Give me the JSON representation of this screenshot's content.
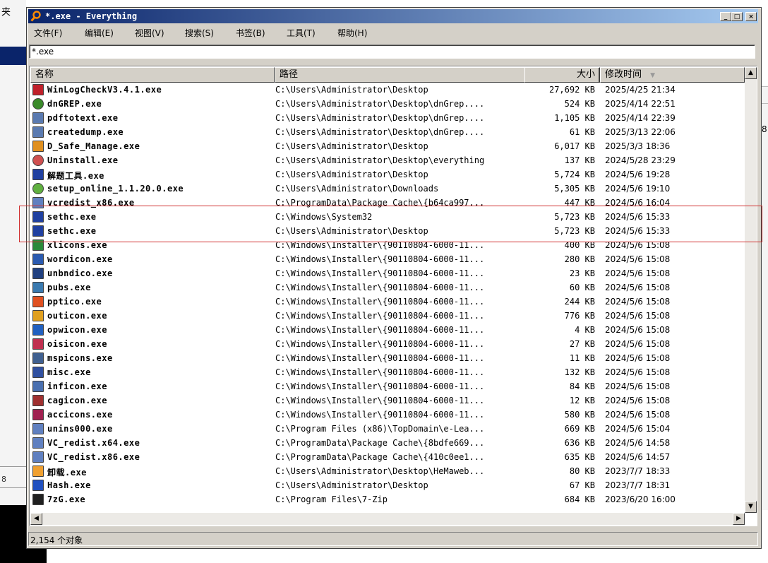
{
  "background": {
    "left_char": "夹",
    "left_number": "8",
    "right_char": "8"
  },
  "window": {
    "title": "*.exe - Everything",
    "min_label": "_",
    "max_label": "□",
    "close_label": "×"
  },
  "menu": [
    "文件(F)",
    "编辑(E)",
    "视图(V)",
    "搜索(S)",
    "书签(B)",
    "工具(T)",
    "帮助(H)"
  ],
  "search": {
    "value": "*.exe"
  },
  "columns": {
    "name": "名称",
    "path": "路径",
    "size": "大小",
    "modified": "修改时间",
    "sort_indicator": "▼"
  },
  "rows": [
    {
      "name": "WinLogCheckV3.4.1.exe",
      "path": "C:\\Users\\Administrator\\Desktop",
      "size": "27,692 KB",
      "modified": "2025/4/25 21:34",
      "icon": "winlogcheck-icon",
      "color": "#c0202a"
    },
    {
      "name": "dnGREP.exe",
      "path": "C:\\Users\\Administrator\\Desktop\\dnGrep....",
      "size": "524 KB",
      "modified": "2025/4/14 22:51",
      "icon": "magnifier-icon",
      "color": "#3a8a2a"
    },
    {
      "name": "pdftotext.exe",
      "path": "C:\\Users\\Administrator\\Desktop\\dnGrep....",
      "size": "1,105 KB",
      "modified": "2025/4/14 22:39",
      "icon": "console-app-icon",
      "color": "#5a7ab0"
    },
    {
      "name": "createdump.exe",
      "path": "C:\\Users\\Administrator\\Desktop\\dnGrep....",
      "size": "61 KB",
      "modified": "2025/3/13 22:06",
      "icon": "console-app-icon",
      "color": "#5a7ab0"
    },
    {
      "name": "D_Safe_Manage.exe",
      "path": "C:\\Users\\Administrator\\Desktop",
      "size": "6,017 KB",
      "modified": "2025/3/3 18:36",
      "icon": "dsafe-icon",
      "color": "#e09020"
    },
    {
      "name": "Uninstall.exe",
      "path": "C:\\Users\\Administrator\\Desktop\\everything",
      "size": "137 KB",
      "modified": "2024/5/28 23:29",
      "icon": "uninstall-icon",
      "color": "#d05050"
    },
    {
      "name": "解题工具.exe",
      "path": "C:\\Users\\Administrator\\Desktop",
      "size": "5,724 KB",
      "modified": "2024/5/6 19:28",
      "icon": "tool-app-icon",
      "color": "#2040a0"
    },
    {
      "name": "setup_online_1.1.20.0.exe",
      "path": "C:\\Users\\Administrator\\Downloads",
      "size": "5,305 KB",
      "modified": "2024/5/6 19:10",
      "icon": "setup-icon",
      "color": "#60b040"
    },
    {
      "name": "vcredist_x86.exe",
      "path": "C:\\ProgramData\\Package Cache\\{b64ca997...",
      "size": "447 KB",
      "modified": "2024/5/6 16:04",
      "icon": "installer-icon",
      "color": "#6080c0"
    },
    {
      "name": "sethc.exe",
      "path": "C:\\Windows\\System32",
      "size": "5,723 KB",
      "modified": "2024/5/6 15:33",
      "icon": "sethc-icon",
      "color": "#2040a0"
    },
    {
      "name": "sethc.exe",
      "path": "C:\\Users\\Administrator\\Desktop",
      "size": "5,723 KB",
      "modified": "2024/5/6 15:33",
      "icon": "sethc-icon",
      "color": "#2040a0"
    },
    {
      "name": "xlicons.exe",
      "path": "C:\\Windows\\Installer\\{90110804-6000-11...",
      "size": "400 KB",
      "modified": "2024/5/6 15:08",
      "icon": "excel-icon",
      "color": "#2a8a3a"
    },
    {
      "name": "wordicon.exe",
      "path": "C:\\Windows\\Installer\\{90110804-6000-11...",
      "size": "280 KB",
      "modified": "2024/5/6 15:08",
      "icon": "word-icon",
      "color": "#2a5ab0"
    },
    {
      "name": "unbndico.exe",
      "path": "C:\\Windows\\Installer\\{90110804-6000-11...",
      "size": "23 KB",
      "modified": "2024/5/6 15:08",
      "icon": "unbound-icon",
      "color": "#204080"
    },
    {
      "name": "pubs.exe",
      "path": "C:\\Windows\\Installer\\{90110804-6000-11...",
      "size": "60 KB",
      "modified": "2024/5/6 15:08",
      "icon": "publisher-icon",
      "color": "#3a7ab0"
    },
    {
      "name": "pptico.exe",
      "path": "C:\\Windows\\Installer\\{90110804-6000-11...",
      "size": "244 KB",
      "modified": "2024/5/6 15:08",
      "icon": "powerpoint-icon",
      "color": "#e05020"
    },
    {
      "name": "outicon.exe",
      "path": "C:\\Windows\\Installer\\{90110804-6000-11...",
      "size": "776 KB",
      "modified": "2024/5/6 15:08",
      "icon": "outlook-icon",
      "color": "#e0a020"
    },
    {
      "name": "opwicon.exe",
      "path": "C:\\Windows\\Installer\\{90110804-6000-11...",
      "size": "4 KB",
      "modified": "2024/5/6 15:08",
      "icon": "opw-icon",
      "color": "#2060c0"
    },
    {
      "name": "oisicon.exe",
      "path": "C:\\Windows\\Installer\\{90110804-6000-11...",
      "size": "27 KB",
      "modified": "2024/5/6 15:08",
      "icon": "ois-icon",
      "color": "#c03050"
    },
    {
      "name": "mspicons.exe",
      "path": "C:\\Windows\\Installer\\{90110804-6000-11...",
      "size": "11 KB",
      "modified": "2024/5/6 15:08",
      "icon": "msp-icon",
      "color": "#406090"
    },
    {
      "name": "misc.exe",
      "path": "C:\\Windows\\Installer\\{90110804-6000-11...",
      "size": "132 KB",
      "modified": "2024/5/6 15:08",
      "icon": "misc-icon",
      "color": "#3050a0"
    },
    {
      "name": "inficon.exe",
      "path": "C:\\Windows\\Installer\\{90110804-6000-11...",
      "size": "84 KB",
      "modified": "2024/5/6 15:08",
      "icon": "infopath-icon",
      "color": "#4a70b0"
    },
    {
      "name": "cagicon.exe",
      "path": "C:\\Windows\\Installer\\{90110804-6000-11...",
      "size": "12 KB",
      "modified": "2024/5/6 15:08",
      "icon": "clipart-icon",
      "color": "#a03030"
    },
    {
      "name": "accicons.exe",
      "path": "C:\\Windows\\Installer\\{90110804-6000-11...",
      "size": "580 KB",
      "modified": "2024/5/6 15:08",
      "icon": "access-icon",
      "color": "#a02050"
    },
    {
      "name": "unins000.exe",
      "path": "C:\\Program Files (x86)\\TopDomain\\e-Lea...",
      "size": "669 KB",
      "modified": "2024/5/6 15:04",
      "icon": "installer-icon",
      "color": "#6080c0"
    },
    {
      "name": "VC_redist.x64.exe",
      "path": "C:\\ProgramData\\Package Cache\\{8bdfe669...",
      "size": "636 KB",
      "modified": "2024/5/6 14:58",
      "icon": "installer-icon",
      "color": "#6080c0"
    },
    {
      "name": "VC_redist.x86.exe",
      "path": "C:\\ProgramData\\Package Cache\\{410c0ee1...",
      "size": "635 KB",
      "modified": "2024/5/6 14:57",
      "icon": "installer-icon",
      "color": "#6080c0"
    },
    {
      "name": "卸载.exe",
      "path": "C:\\Users\\Administrator\\Desktop\\HeMaweb...",
      "size": "80 KB",
      "modified": "2023/7/7 18:33",
      "icon": "uninstall-app-icon",
      "color": "#f0a030"
    },
    {
      "name": "Hash.exe",
      "path": "C:\\Users\\Administrator\\Desktop",
      "size": "67 KB",
      "modified": "2023/7/7 18:31",
      "icon": "hash-icon",
      "color": "#2050c0"
    },
    {
      "name": "7zG.exe",
      "path": "C:\\Program Files\\7-Zip",
      "size": "684 KB",
      "modified": "2023/6/20 16:00",
      "icon": "7zip-icon",
      "color": "#202020"
    }
  ],
  "status": {
    "count": "2,154 个对象"
  },
  "accent": {
    "titlebar": "#0a246a",
    "highlight": "#d03030"
  }
}
